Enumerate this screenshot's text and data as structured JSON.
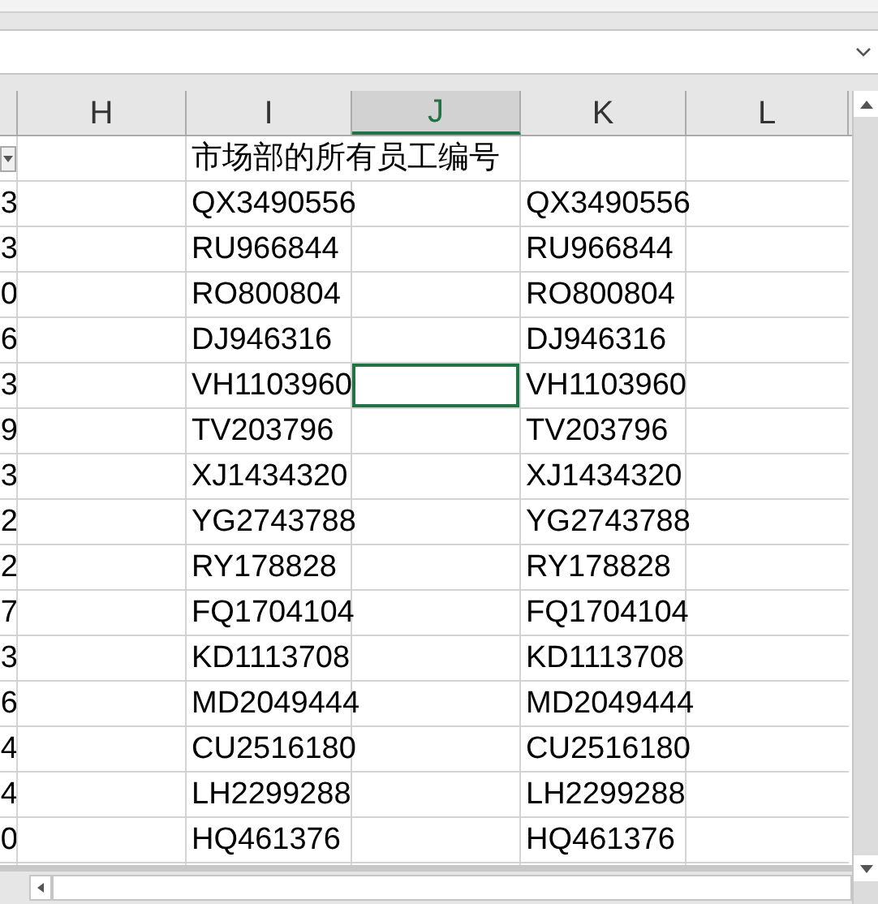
{
  "columns": [
    {
      "label": "H",
      "selected": false
    },
    {
      "label": "I",
      "selected": false
    },
    {
      "label": "J",
      "selected": true
    },
    {
      "label": "K",
      "selected": false
    },
    {
      "label": "L",
      "selected": false
    }
  ],
  "header_row": {
    "title": "市场部的所有员工编号"
  },
  "rows": [
    {
      "column_g": "3",
      "i": "QX3490556",
      "j_selected": false,
      "k": "QX3490556"
    },
    {
      "column_g": "3",
      "i": "RU966844",
      "j_selected": false,
      "k": "RU966844"
    },
    {
      "column_g": "0",
      "i": "RO800804",
      "j_selected": false,
      "k": "RO800804"
    },
    {
      "column_g": "6",
      "i": "DJ946316",
      "j_selected": false,
      "k": "DJ946316"
    },
    {
      "column_g": "3",
      "i": "VH1103960",
      "j_selected": true,
      "k": "VH1103960"
    },
    {
      "column_g": "9",
      "i": "TV203796",
      "j_selected": false,
      "k": "TV203796"
    },
    {
      "column_g": "3",
      "i": "XJ1434320",
      "j_selected": false,
      "k": "XJ1434320"
    },
    {
      "column_g": "2",
      "i": "YG2743788",
      "j_selected": false,
      "k": "YG2743788"
    },
    {
      "column_g": "2",
      "i": "RY178828",
      "j_selected": false,
      "k": "RY178828"
    },
    {
      "column_g": "7",
      "i": "FQ1704104",
      "j_selected": false,
      "k": "FQ1704104"
    },
    {
      "column_g": "3",
      "i": "KD1113708",
      "j_selected": false,
      "k": "KD1113708"
    },
    {
      "column_g": "6",
      "i": "MD2049444",
      "j_selected": false,
      "k": "MD2049444"
    },
    {
      "column_g": "4",
      "i": "CU2516180",
      "j_selected": false,
      "k": "CU2516180"
    },
    {
      "column_g": "4",
      "i": "LH2299288",
      "j_selected": false,
      "k": "LH2299288"
    },
    {
      "column_g": "0",
      "i": "HQ461376",
      "j_selected": false,
      "k": "HQ461376"
    }
  ]
}
